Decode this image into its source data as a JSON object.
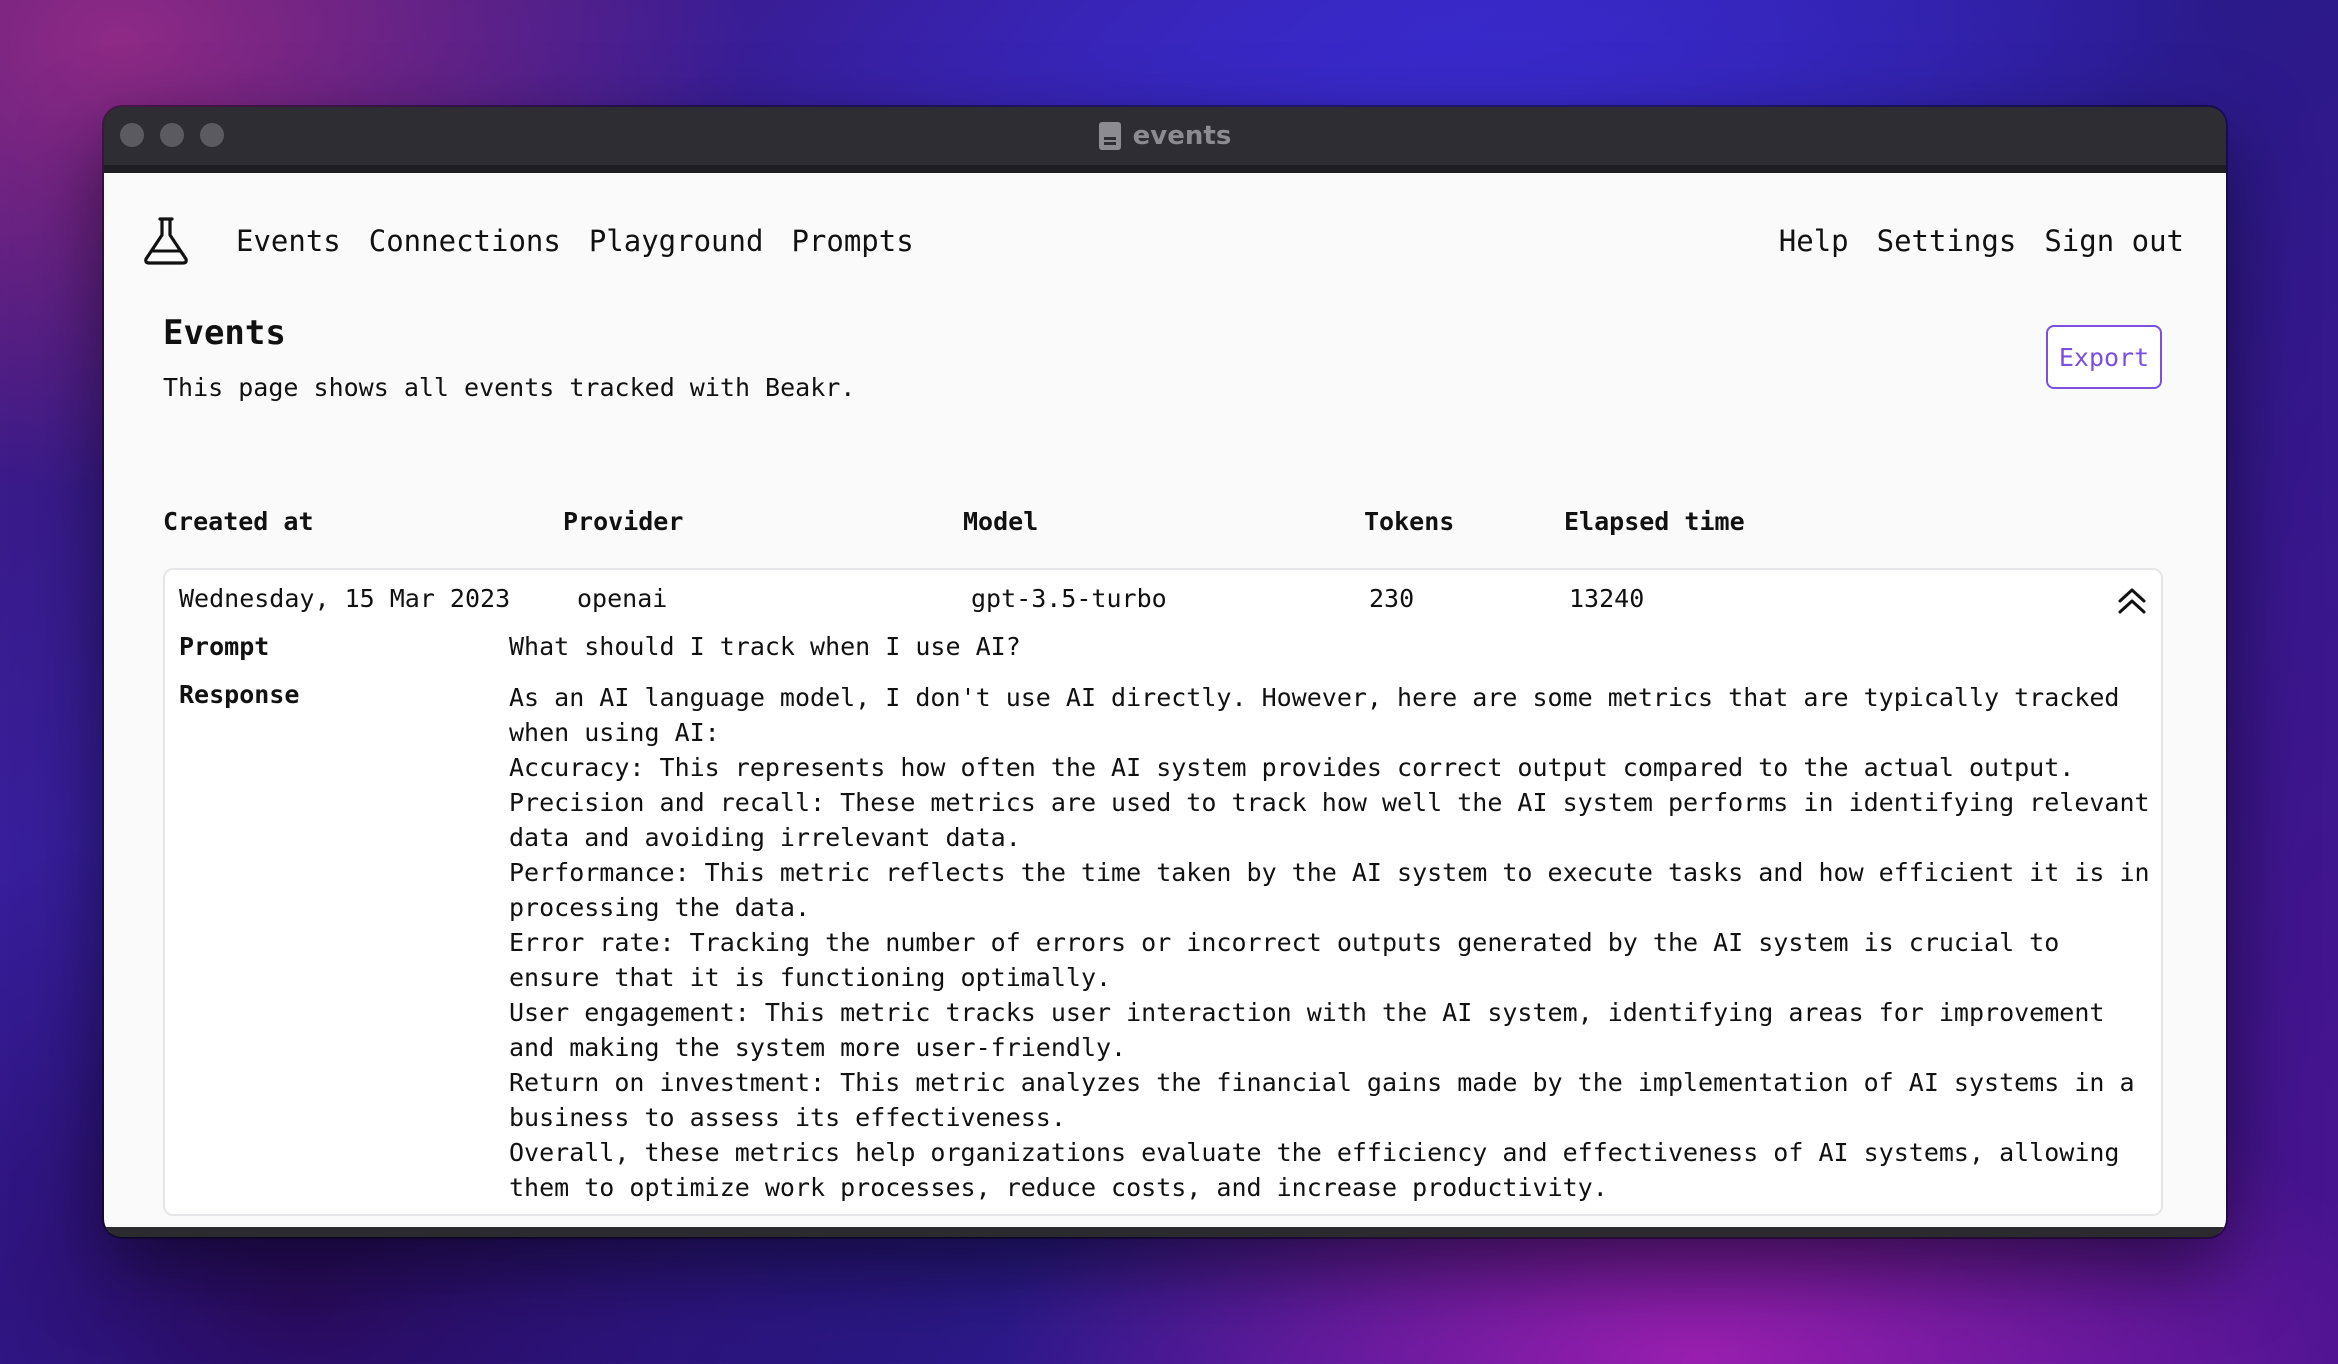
{
  "window": {
    "title": "events"
  },
  "nav": {
    "left": [
      "Events",
      "Connections",
      "Playground",
      "Prompts"
    ],
    "right": [
      "Help",
      "Settings",
      "Sign out"
    ]
  },
  "page": {
    "title": "Events",
    "description": "This page shows all events tracked with Beakr.",
    "export_label": "Export"
  },
  "table": {
    "columns": [
      "Created at",
      "Provider",
      "Model",
      "Tokens",
      "Elapsed time"
    ],
    "event": {
      "created_at": "Wednesday, 15 Mar 2023",
      "provider": "openai",
      "model": "gpt-3.5-turbo",
      "tokens": "230",
      "elapsed_time": "13240",
      "prompt_label": "Prompt",
      "prompt": "What should I track when I use AI?",
      "response_label": "Response",
      "response_lines": [
        "As an AI language model, I don't use AI directly. However, here are some metrics that are typically tracked when using AI:",
        "Accuracy: This represents how often the AI system provides correct output compared to the actual output.",
        "Precision and recall: These metrics are used to track how well the AI system performs in identifying relevant data and avoiding irrelevant data.",
        "Performance: This metric reflects the time taken by the AI system to execute tasks and how efficient it is in processing the data.",
        "Error rate: Tracking the number of errors or incorrect outputs generated by the AI system is crucial to ensure that it is functioning optimally.",
        "User engagement: This metric tracks user interaction with the AI system, identifying areas for improvement and making the system more user-friendly.",
        "Return on investment: This metric analyzes the financial gains made by the implementation of AI systems in a business to assess its effectiveness.",
        "Overall, these metrics help organizations evaluate the efficiency and effectiveness of AI systems, allowing them to optimize work processes, reduce costs, and increase productivity."
      ]
    }
  },
  "icons": {
    "logo": "flask-icon",
    "collapse": "chevron-double-up-icon",
    "title_doc": "document-icon"
  }
}
